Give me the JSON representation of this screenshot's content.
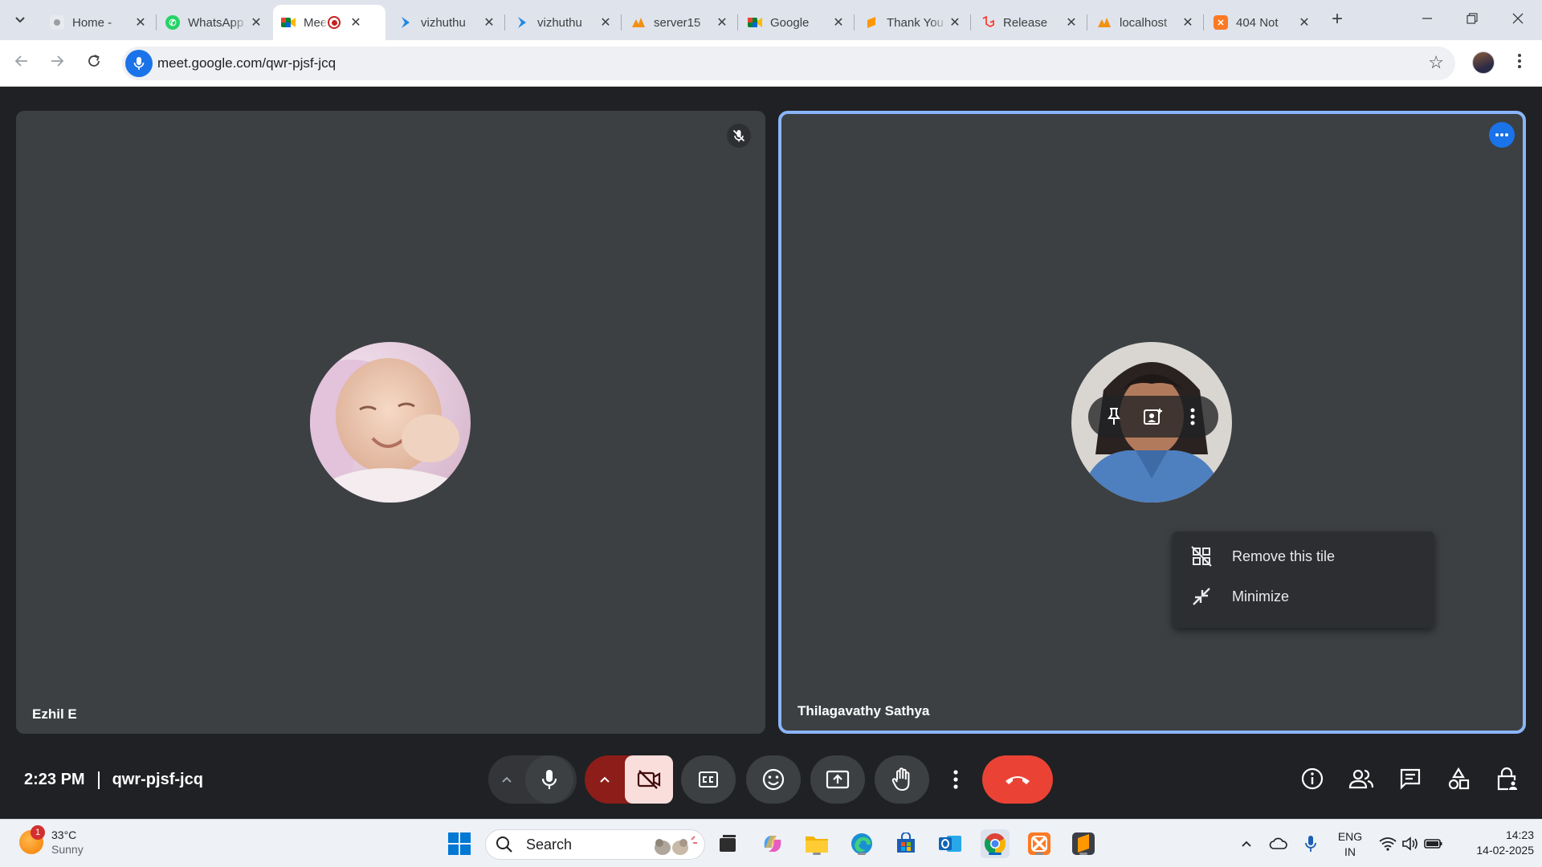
{
  "browser": {
    "tabs": [
      {
        "label": "Home - ​",
        "favicon": "generic-icon",
        "active": false
      },
      {
        "label": "WhatsApp",
        "favicon": "whatsapp-icon",
        "active": false
      },
      {
        "label": "Meet",
        "favicon": "meet-icon",
        "active": true
      },
      {
        "label": "vizhuthu",
        "favicon": "vizhuthu-icon",
        "active": false
      },
      {
        "label": "vizhuthu",
        "favicon": "vizhuthu-icon",
        "active": false
      },
      {
        "label": "server15",
        "favicon": "phpmyadmin-icon",
        "active": false
      },
      {
        "label": "Google",
        "favicon": "meet-icon",
        "active": false
      },
      {
        "label": "Thank You",
        "favicon": "sublime-icon",
        "active": false
      },
      {
        "label": "Release",
        "favicon": "laravel-icon",
        "active": false
      },
      {
        "label": "localhost",
        "favicon": "phpmyadmin-icon",
        "active": false
      },
      {
        "label": "404 Not",
        "favicon": "xampp-icon",
        "active": false
      }
    ],
    "url": "meet.google.com/qwr-pjsf-jcq"
  },
  "meeting": {
    "time": "2:23 PM",
    "code": "qwr-pjsf-jcq",
    "participants": [
      {
        "name": "Ezhil E",
        "muted": true
      },
      {
        "name": "Thilagavathy Sathya",
        "muted": false
      }
    ],
    "participant_count": "2",
    "context_menu": [
      {
        "label": "Remove this tile",
        "icon": "remove-tile-icon"
      },
      {
        "label": "Minimize",
        "icon": "minimize-icon"
      }
    ]
  },
  "taskbar": {
    "weather": {
      "temp": "33°C",
      "condition": "Sunny",
      "badge": "1"
    },
    "search_label": "Search",
    "lang_top": "ENG",
    "lang_bottom": "IN",
    "clock_time": "14:23",
    "clock_date": "14-02-2025"
  },
  "colors": {
    "accent_blue": "#1a73e8",
    "tile_border": "#8ab4f8",
    "end_call_red": "#ea4335",
    "camera_off_bg": "#f9dedc",
    "meet_bg": "#202124",
    "tile_bg": "#3c4043"
  }
}
